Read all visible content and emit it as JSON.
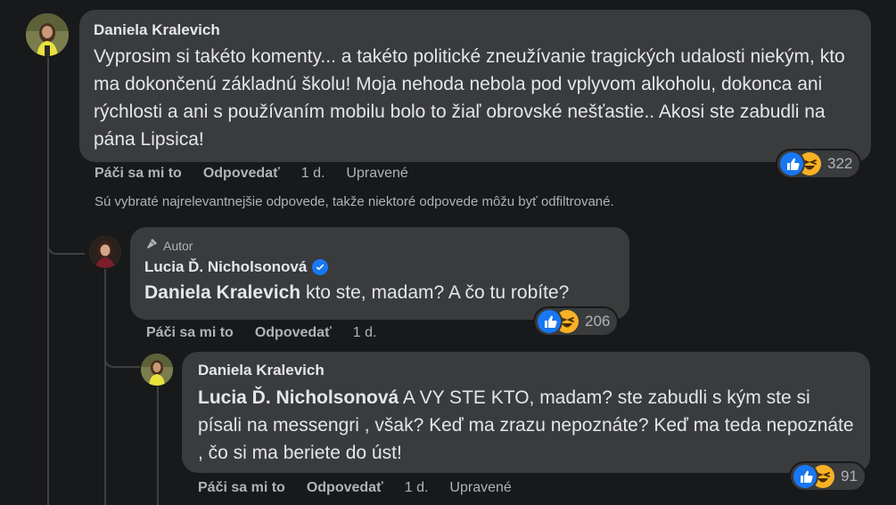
{
  "comment": {
    "author": "Daniela Kralevich",
    "text": "Vyprosim si takéto komenty... a takéto politické zneužívanie tragických udalosti niekým, kto ma dokončenú základnú školu! Moja nehoda nebola pod vplyvom alkoholu, dokonca ani rýchlosti a ani s používaním mobilu bolo to žiaľ obrovské nešťastie.. Akosi ste zabudli na pána Lipsica!",
    "like_label": "Páči sa mi to",
    "reply_label": "Odpovedať",
    "time": "1 d.",
    "edited": "Upravené",
    "reaction_count": "322"
  },
  "filter_note": "Sú vybraté najrelevantnejšie odpovede, takže niektoré odpovede môžu byť odfiltrované.",
  "reply1": {
    "badge": "Autor",
    "author": "Lucia Ď. Nicholsonová",
    "mention": "Daniela Kralevich",
    "text": "kto ste, madam? A čo tu robíte?",
    "like_label": "Páči sa mi to",
    "reply_label": "Odpovedať",
    "time": "1 d.",
    "reaction_count": "206"
  },
  "reply2": {
    "author": "Daniela Kralevich",
    "mention": "Lucia Ď. Nicholsonová",
    "text": "A VY STE KTO, madam? ste zabudli s kým ste si písali na messengri , však? Keď ma zrazu nepoznáte? Keď ma teda nepoznáte , čo si ma beriete do úst!",
    "like_label": "Páči sa mi to",
    "reply_label": "Odpovedať",
    "time": "1 d.",
    "edited": "Upravené",
    "reaction_count": "91"
  },
  "icons": {
    "like": "thumbs-up-icon",
    "haha": "laughing-face-icon",
    "author_badge": "microphone-icon",
    "verified": "verified-check-icon"
  },
  "colors": {
    "background": "#18191a",
    "bubble": "#3a3b3c",
    "text": "#e4e6eb",
    "secondary_text": "#b0b3b8",
    "like_blue": "#1877f2",
    "haha_yellow": "#f7b125"
  }
}
